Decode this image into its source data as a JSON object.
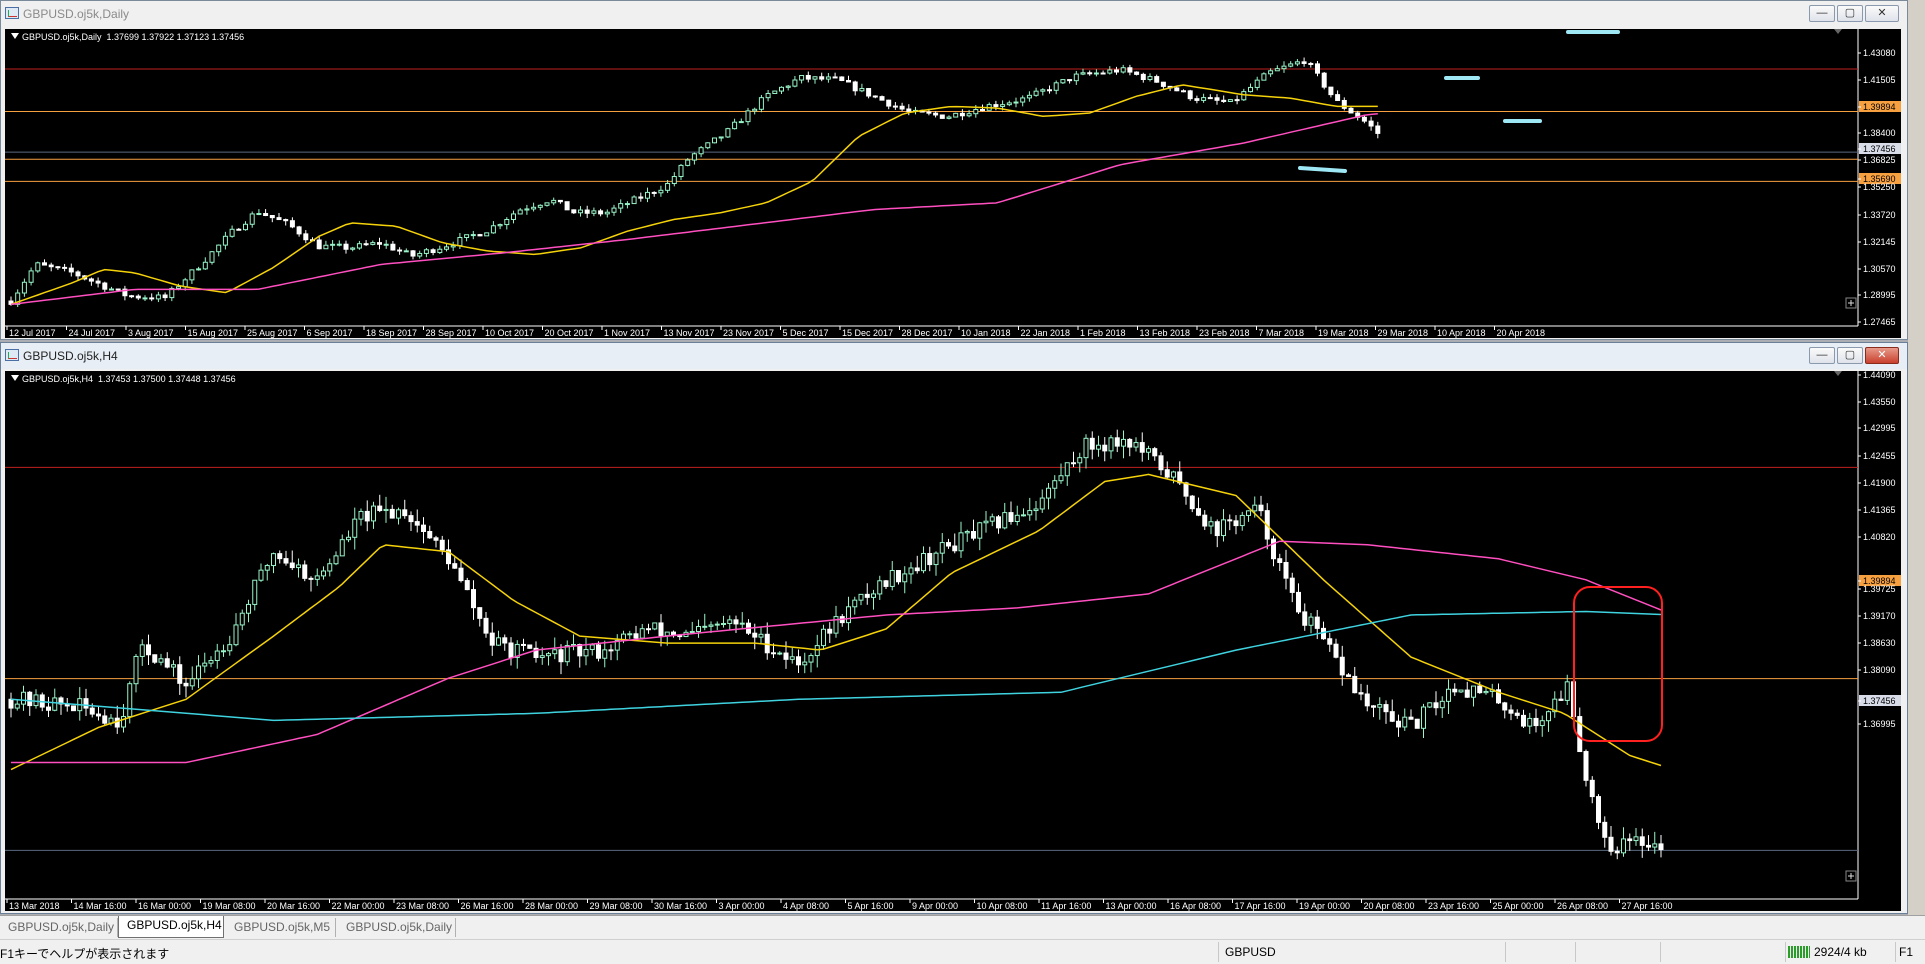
{
  "windows": [
    {
      "title": "GBPUSD.oj5k,Daily",
      "header": "GBPUSD.oj5k,Daily  1.37699 1.37922 1.37123 1.37456",
      "active": false
    },
    {
      "title": "GBPUSD.oj5k,H4",
      "header": "GBPUSD.oj5k,H4  1.37453 1.37500 1.37448 1.37456",
      "active": true
    }
  ],
  "daily": {
    "price_labels": [
      "1.43080",
      "1.41505",
      "1.39894",
      "1.38400",
      "1.37456",
      "1.36825",
      "1.35690",
      "1.35250",
      "1.33720",
      "1.32145",
      "1.30570",
      "1.28995",
      "1.27465"
    ],
    "time_labels": [
      "12 Jul 2017",
      "24 Jul 2017",
      "3 Aug 2017",
      "15 Aug 2017",
      "25 Aug 2017",
      "6 Sep 2017",
      "18 Sep 2017",
      "28 Sep 2017",
      "10 Oct 2017",
      "20 Oct 2017",
      "1 Nov 2017",
      "13 Nov 2017",
      "23 Nov 2017",
      "5 Dec 2017",
      "15 Dec 2017",
      "28 Dec 2017",
      "10 Jan 2018",
      "22 Jan 2018",
      "1 Feb 2018",
      "13 Feb 2018",
      "23 Feb 2018",
      "7 Mar 2018",
      "19 Mar 2018",
      "29 Mar 2018",
      "10 Apr 2018",
      "20 Apr 2018"
    ]
  },
  "h4": {
    "price_labels": [
      "1.44090",
      "1.43550",
      "1.42995",
      "1.42455",
      "1.41900",
      "1.41365",
      "1.40820",
      "1.39894",
      "1.39725",
      "1.39170",
      "1.38630",
      "1.38090",
      "1.37456",
      "1.36995"
    ],
    "time_labels": [
      "13 Mar 2018",
      "14 Mar 16:00",
      "16 Mar 00:00",
      "19 Mar 08:00",
      "20 Mar 16:00",
      "22 Mar 00:00",
      "23 Mar 08:00",
      "26 Mar 16:00",
      "28 Mar 00:00",
      "29 Mar 08:00",
      "30 Mar 16:00",
      "3 Apr 00:00",
      "4 Apr 08:00",
      "5 Apr 16:00",
      "9 Apr 00:00",
      "10 Apr 08:00",
      "11 Apr 16:00",
      "13 Apr 00:00",
      "16 Apr 08:00",
      "17 Apr 16:00",
      "19 Apr 00:00",
      "20 Apr 08:00",
      "23 Apr 16:00",
      "25 Apr 00:00",
      "26 Apr 08:00",
      "27 Apr 16:00"
    ]
  },
  "tabs": [
    "GBPUSD.oj5k,Daily",
    "GBPUSD.oj5k,H4",
    "GBPUSD.oj5k,M5",
    "GBPUSD.oj5k,Daily"
  ],
  "status": {
    "help": "F1キーでヘルプが表示されます",
    "symbol": "GBPUSD",
    "traffic": "2924/4 kb",
    "fkey": "F1"
  },
  "colors": {
    "up": "#98f5c8",
    "down": "#ffffff",
    "ma_fast": "#f5d20a",
    "ma_mid": "#ff4fc0",
    "ma_slow": "#3fd3e0",
    "resistance": "#c0201e",
    "support": "#f7a040",
    "bid": "#5a6a80"
  }
}
